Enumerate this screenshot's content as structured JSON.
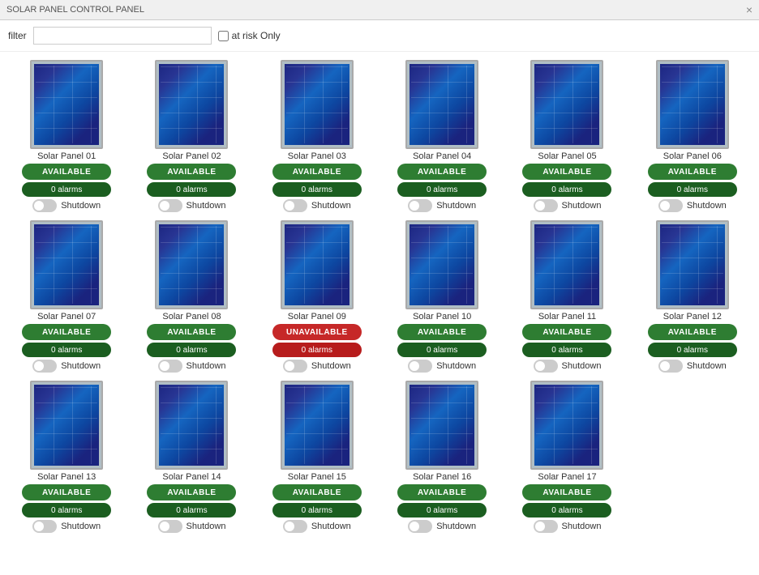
{
  "titleBar": {
    "title": "SOLAR PANEL CONTROL PANEL",
    "closeIcon": "×"
  },
  "filterBar": {
    "filterLabel": "filter",
    "filterPlaceholder": "",
    "filterValue": "",
    "atRiskLabel": "at risk Only",
    "atRiskChecked": false
  },
  "panels": [
    {
      "id": 1,
      "name": "Solar Panel 01",
      "status": "AVAILABLE",
      "alarms": "0 alarms",
      "shutdown": false,
      "available": true
    },
    {
      "id": 2,
      "name": "Solar Panel 02",
      "status": "AVAILABLE",
      "alarms": "0 alarms",
      "shutdown": false,
      "available": true
    },
    {
      "id": 3,
      "name": "Solar Panel 03",
      "status": "AVAILABLE",
      "alarms": "0 alarms",
      "shutdown": false,
      "available": true
    },
    {
      "id": 4,
      "name": "Solar Panel 04",
      "status": "AVAILABLE",
      "alarms": "0 alarms",
      "shutdown": false,
      "available": true
    },
    {
      "id": 5,
      "name": "Solar Panel 05",
      "status": "AVAILABLE",
      "alarms": "0 alarms",
      "shutdown": false,
      "available": true
    },
    {
      "id": 6,
      "name": "Solar Panel 06",
      "status": "AVAILABLE",
      "alarms": "0 alarms",
      "shutdown": false,
      "available": true
    },
    {
      "id": 7,
      "name": "Solar Panel 07",
      "status": "AVAILABLE",
      "alarms": "0 alarms",
      "shutdown": false,
      "available": true
    },
    {
      "id": 8,
      "name": "Solar Panel 08",
      "status": "AVAILABLE",
      "alarms": "0 alarms",
      "shutdown": false,
      "available": true
    },
    {
      "id": 9,
      "name": "Solar Panel 09",
      "status": "UNAVAILABLE",
      "alarms": "0 alarms",
      "shutdown": false,
      "available": false
    },
    {
      "id": 10,
      "name": "Solar Panel 10",
      "status": "AVAILABLE",
      "alarms": "0 alarms",
      "shutdown": false,
      "available": true
    },
    {
      "id": 11,
      "name": "Solar Panel 11",
      "status": "AVAILABLE",
      "alarms": "0 alarms",
      "shutdown": false,
      "available": true
    },
    {
      "id": 12,
      "name": "Solar Panel 12",
      "status": "AVAILABLE",
      "alarms": "0 alarms",
      "shutdown": false,
      "available": true
    },
    {
      "id": 13,
      "name": "Solar Panel 13",
      "status": "AVAILABLE",
      "alarms": "0 alarms",
      "shutdown": false,
      "available": true
    },
    {
      "id": 14,
      "name": "Solar Panel 14",
      "status": "AVAILABLE",
      "alarms": "0 alarms",
      "shutdown": false,
      "available": true
    },
    {
      "id": 15,
      "name": "Solar Panel 15",
      "status": "AVAILABLE",
      "alarms": "0 alarms",
      "shutdown": false,
      "available": true
    },
    {
      "id": 16,
      "name": "Solar Panel 16",
      "status": "AVAILABLE",
      "alarms": "0 alarms",
      "shutdown": false,
      "available": true
    },
    {
      "id": 17,
      "name": "Solar Panel 17",
      "status": "AVAILABLE",
      "alarms": "0 alarms",
      "shutdown": false,
      "available": true
    }
  ],
  "shutdownLabel": "Shutdown"
}
